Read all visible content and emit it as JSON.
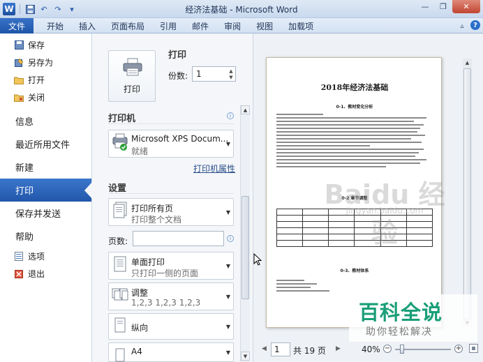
{
  "window": {
    "title": "经济法基础 - Microsoft Word",
    "app_logo": "W"
  },
  "ribbon": {
    "file_tab": "文件",
    "tabs": [
      "开始",
      "插入",
      "页面布局",
      "引用",
      "邮件",
      "审阅",
      "视图",
      "加载项"
    ]
  },
  "backstage_nav": {
    "small_top": [
      {
        "label": "保存",
        "icon": "save-icon"
      },
      {
        "label": "另存为",
        "icon": "save-as-icon"
      },
      {
        "label": "打开",
        "icon": "open-folder-icon"
      },
      {
        "label": "关闭",
        "icon": "close-doc-icon"
      }
    ],
    "big": [
      "信息",
      "最近所用文件",
      "新建",
      "打印",
      "保存并发送",
      "帮助"
    ],
    "active": "打印",
    "small_bottom": [
      {
        "label": "选项",
        "icon": "options-icon"
      },
      {
        "label": "退出",
        "icon": "exit-icon"
      }
    ]
  },
  "print_panel": {
    "section_print": "打印",
    "print_button": "打印",
    "copies_label": "份数:",
    "copies_value": "1",
    "section_printer": "打印机",
    "printer_name": "Microsoft XPS Docum...",
    "printer_status": "就绪",
    "printer_properties_link": "打印机属性",
    "section_settings": "设置",
    "range_main": "打印所有页",
    "range_sub": "打印整个文档",
    "pages_label": "页数:",
    "pages_value": "",
    "sides_main": "单面打印",
    "sides_sub": "只打印一侧的页面",
    "collate_main": "调整",
    "collate_sub": "1,2,3    1,2,3    1,2,3",
    "orientation": "纵向",
    "paper": "A4"
  },
  "preview": {
    "doc_title": "2018年经济法基础",
    "heading_1": "0-1、教材变化分析",
    "heading_2": "0-2 章节调整",
    "heading_3": "0-3、教材体系",
    "page_current": "1",
    "page_total": "共 19 页",
    "zoom": "40%"
  },
  "overlays": {
    "watermark": "Baidu 经验",
    "watermark_sub": "jingyan.baidu.com",
    "baike_big": "百科全说",
    "baike_small": "助你轻松解决"
  },
  "colors": {
    "file_tab": "#1e55a8",
    "active_nav": "#2257aa",
    "baike_green": "#1a9e78"
  }
}
